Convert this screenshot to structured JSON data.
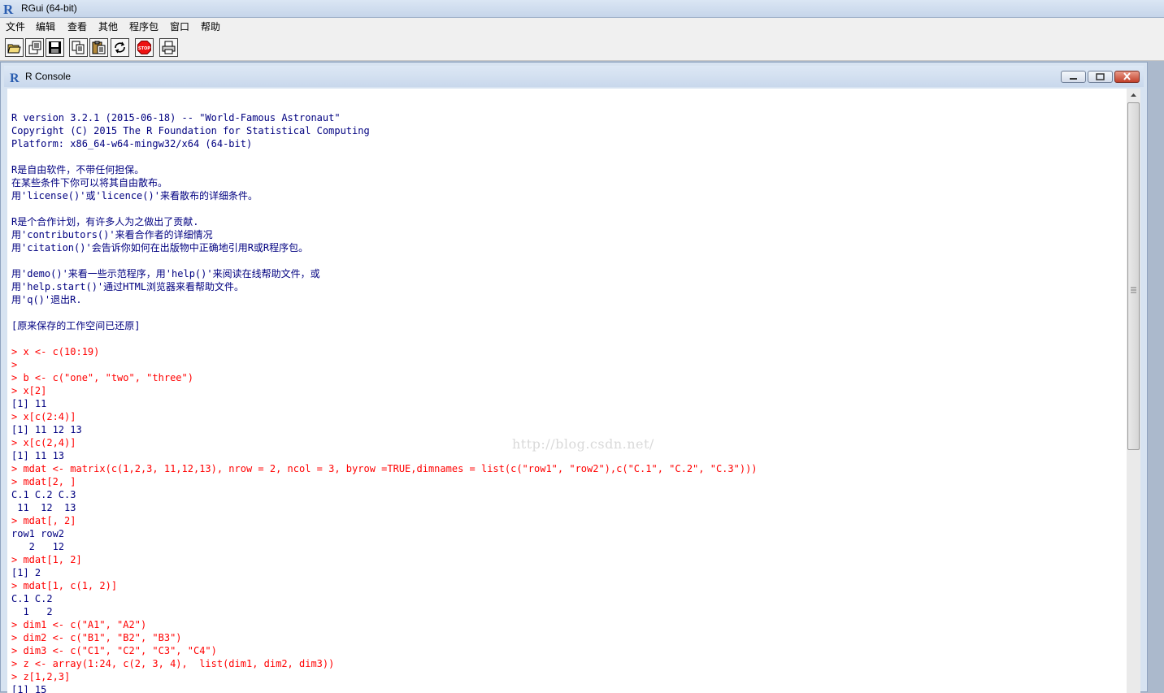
{
  "window": {
    "title": "RGui (64-bit)"
  },
  "menu": [
    "文件",
    "编辑",
    "查看",
    "其他",
    "程序包",
    "窗口",
    "帮助"
  ],
  "toolbar": {
    "buttons": [
      "open-script-icon",
      "load-workspace-icon",
      "save-icon",
      "copy-icon",
      "paste-icon",
      "copy-paste-icon",
      "stop-icon",
      "print-icon"
    ]
  },
  "console": {
    "title": "R Console",
    "lines": [
      {
        "text": "R version 3.2.1 (2015-06-18) -- \"World-Famous Astronaut\"",
        "kind": "out"
      },
      {
        "text": "Copyright (C) 2015 The R Foundation for Statistical Computing",
        "kind": "out"
      },
      {
        "text": "Platform: x86_64-w64-mingw32/x64 (64-bit)",
        "kind": "out"
      },
      {
        "text": "",
        "kind": "out"
      },
      {
        "text": "R是自由软件，不带任何担保。",
        "kind": "out"
      },
      {
        "text": "在某些条件下你可以将其自由散布。",
        "kind": "out"
      },
      {
        "text": "用'license()'或'licence()'来看散布的详细条件。",
        "kind": "out"
      },
      {
        "text": "",
        "kind": "out"
      },
      {
        "text": "R是个合作计划，有许多人为之做出了贡献.",
        "kind": "out"
      },
      {
        "text": "用'contributors()'来看合作者的详细情况",
        "kind": "out"
      },
      {
        "text": "用'citation()'会告诉你如何在出版物中正确地引用R或R程序包。",
        "kind": "out"
      },
      {
        "text": "",
        "kind": "out"
      },
      {
        "text": "用'demo()'来看一些示范程序，用'help()'来阅读在线帮助文件，或",
        "kind": "out"
      },
      {
        "text": "用'help.start()'通过HTML浏览器来看帮助文件。",
        "kind": "out"
      },
      {
        "text": "用'q()'退出R.",
        "kind": "out"
      },
      {
        "text": "",
        "kind": "out"
      },
      {
        "text": "[原来保存的工作空间已还原]",
        "kind": "out"
      },
      {
        "text": "",
        "kind": "out"
      },
      {
        "text": "> x <- c(10:19)",
        "kind": "in"
      },
      {
        "text": ">",
        "kind": "in"
      },
      {
        "text": "> b <- c(\"one\", \"two\", \"three\")",
        "kind": "in"
      },
      {
        "text": "> x[2]",
        "kind": "in"
      },
      {
        "text": "[1] 11",
        "kind": "out"
      },
      {
        "text": "> x[c(2:4)]",
        "kind": "in"
      },
      {
        "text": "[1] 11 12 13",
        "kind": "out"
      },
      {
        "text": "> x[c(2,4)]",
        "kind": "in"
      },
      {
        "text": "[1] 11 13",
        "kind": "out"
      },
      {
        "text": "> mdat <- matrix(c(1,2,3, 11,12,13), nrow = 2, ncol = 3, byrow =TRUE,dimnames = list(c(\"row1\", \"row2\"),c(\"C.1\", \"C.2\", \"C.3\")))",
        "kind": "in"
      },
      {
        "text": "> mdat[2, ]",
        "kind": "in"
      },
      {
        "text": "C.1 C.2 C.3",
        "kind": "out"
      },
      {
        "text": " 11  12  13",
        "kind": "out"
      },
      {
        "text": "> mdat[, 2]",
        "kind": "in"
      },
      {
        "text": "row1 row2",
        "kind": "out"
      },
      {
        "text": "   2   12",
        "kind": "out"
      },
      {
        "text": "> mdat[1, 2]",
        "kind": "in"
      },
      {
        "text": "[1] 2",
        "kind": "out"
      },
      {
        "text": "> mdat[1, c(1, 2)]",
        "kind": "in"
      },
      {
        "text": "C.1 C.2",
        "kind": "out"
      },
      {
        "text": "  1   2",
        "kind": "out"
      },
      {
        "text": "> dim1 <- c(\"A1\", \"A2\")",
        "kind": "in"
      },
      {
        "text": "> dim2 <- c(\"B1\", \"B2\", \"B3\")",
        "kind": "in"
      },
      {
        "text": "> dim3 <- c(\"C1\", \"C2\", \"C3\", \"C4\")",
        "kind": "in"
      },
      {
        "text": "> z <- array(1:24, c(2, 3, 4),  list(dim1, dim2, dim3))",
        "kind": "in"
      },
      {
        "text": "> z[1,2,3]",
        "kind": "in"
      },
      {
        "text": "[1] 15",
        "kind": "out"
      }
    ]
  },
  "watermark": "http://blog.csdn.net/",
  "colors": {
    "input": "#ff0000",
    "output": "#000080",
    "console_bg": "#ffffff"
  }
}
